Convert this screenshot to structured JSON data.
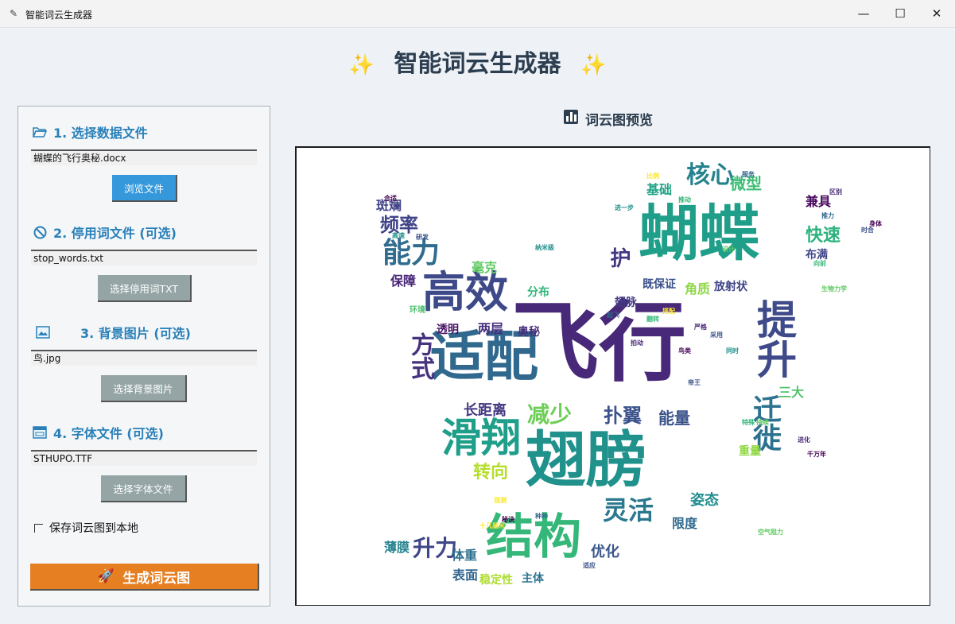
{
  "window": {
    "title": "智能词云生成器",
    "app_icon": "feather-icon",
    "controls": {
      "minimize": "—",
      "maximize": "☐",
      "close": "✕"
    }
  },
  "app": {
    "heading": "智能词云生成器",
    "sparkle": "✨"
  },
  "sections": {
    "data_file": {
      "icon": "📂",
      "title": "1. 选择数据文件",
      "value": "蝴蝶的飞行奥秘.docx",
      "button": "浏览文件"
    },
    "stopwords": {
      "icon": "🚫",
      "title": "2. 停用词文件 (可选)",
      "value": "stop_words.txt",
      "button": "选择停用词TXT"
    },
    "background": {
      "icon": "🖼",
      "title": "3. 背景图片 (可选)",
      "value": "鸟.jpg",
      "button": "选择背景图片"
    },
    "font": {
      "icon": "🗔",
      "title": "4. 字体文件 (可选)",
      "value": "STHUPO.TTF",
      "button": "选择字体文件"
    }
  },
  "save_option": {
    "label": "保存词云图到本地",
    "checked": false
  },
  "generate": {
    "icon": "🚀",
    "label": "生成词云图"
  },
  "preview": {
    "icon": "📊",
    "title": "词云图预览"
  },
  "colors": {
    "accent_blue": "#3498db",
    "accent_orange": "#e67e22",
    "button_gray": "#95a5a6",
    "heading": "#2c3e50",
    "section_title": "#2980b9"
  },
  "wordcloud": {
    "words": [
      {
        "text": "飞行",
        "color": "#482878"
      },
      {
        "text": "蝴蝶",
        "color": "#1f9e89"
      },
      {
        "text": "适配",
        "color": "#31688e"
      },
      {
        "text": "翅膀",
        "color": "#21918c"
      },
      {
        "text": "结构",
        "color": "#35b779"
      },
      {
        "text": "滑翔",
        "color": "#1f9e89"
      },
      {
        "text": "提升",
        "color": "#3e4a89"
      },
      {
        "text": "高效",
        "color": "#3e4989"
      },
      {
        "text": "能力",
        "color": "#2f6c8e"
      },
      {
        "text": "核心",
        "color": "#26828e"
      },
      {
        "text": "升力",
        "color": "#3f4788"
      },
      {
        "text": "灵活",
        "color": "#2a788e"
      },
      {
        "text": "减少",
        "color": "#6ece58"
      },
      {
        "text": "扑翼",
        "color": "#3b528b"
      },
      {
        "text": "迁徙",
        "color": "#2c728e"
      },
      {
        "text": "转向",
        "color": "#b5de2b"
      },
      {
        "text": "方式",
        "color": "#46327e"
      },
      {
        "text": "频率",
        "color": "#404387"
      },
      {
        "text": "护",
        "color": "#453781"
      },
      {
        "text": "快速",
        "color": "#2db27d"
      },
      {
        "text": "微型",
        "color": "#3dbc74"
      },
      {
        "text": "基础",
        "color": "#20a386"
      },
      {
        "text": "体重",
        "color": "#2e6f8e"
      },
      {
        "text": "优化",
        "color": "#39558c"
      },
      {
        "text": "姿态",
        "color": "#228c8d"
      },
      {
        "text": "薄膜",
        "color": "#25838e"
      },
      {
        "text": "既保证",
        "color": "#3b518b"
      },
      {
        "text": "放射状",
        "color": "#414487"
      },
      {
        "text": "长距离",
        "color": "#443983"
      },
      {
        "text": "保障",
        "color": "#482475"
      },
      {
        "text": "斑斓",
        "color": "#414487"
      },
      {
        "text": "能量",
        "color": "#3a538b"
      },
      {
        "text": "稳定性",
        "color": "#addc30"
      },
      {
        "text": "表面",
        "color": "#32658e"
      },
      {
        "text": "限度",
        "color": "#306a8e"
      },
      {
        "text": "兼具",
        "color": "#46085c"
      },
      {
        "text": "毫克",
        "color": "#5ec962"
      },
      {
        "text": "两层",
        "color": "#46307e"
      },
      {
        "text": "透明",
        "color": "#471365"
      },
      {
        "text": "角质",
        "color": "#8fd744"
      },
      {
        "text": "奥秘",
        "color": "#472d7b"
      },
      {
        "text": "分布",
        "color": "#31b57b"
      },
      {
        "text": "主体",
        "color": "#2c728e"
      },
      {
        "text": "重量",
        "color": "#90d743"
      },
      {
        "text": "三大",
        "color": "#50c46a"
      },
      {
        "text": "布满",
        "color": "#404588"
      },
      {
        "text": "翅脉",
        "color": "#443b84"
      },
      {
        "text": "环境",
        "color": "#4ac16d"
      }
    ],
    "small_words": [
      "合适",
      "研发",
      "高速",
      "设计",
      "比例",
      "服务",
      "推动",
      "区别",
      "身体",
      "时合",
      "进一步",
      "空气阻力",
      "十几厘米",
      "推力",
      "向前",
      "严格",
      "秘诀",
      "帝王",
      "纳米级",
      "生物力学",
      "搭配",
      "起飞",
      "翻转",
      "拍动",
      "鸟类",
      "采用",
      "同时",
      "持续",
      "观测",
      "种种",
      "特殊",
      "进化",
      "千万年",
      "适应"
    ]
  }
}
